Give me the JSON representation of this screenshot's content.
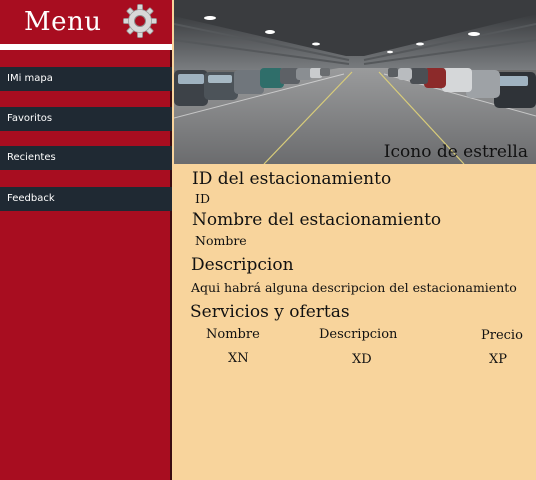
{
  "sidebar": {
    "title": "Menu",
    "settings_icon": "gear-icon",
    "items": [
      {
        "label": "IMi mapa"
      },
      {
        "label": "Favoritos"
      },
      {
        "label": "Recientes"
      },
      {
        "label": "Feedback"
      }
    ]
  },
  "photo": {
    "subject": "parking-garage-photo",
    "caption": "Icono de estrella"
  },
  "details": {
    "id_heading": "ID del estacionamiento",
    "id_value": "ID",
    "name_heading": "Nombre del estacionamiento",
    "name_value": "Nombre",
    "description_heading": "Descripcion",
    "description_value": "Aqui habrá alguna descripcion del estacionamiento",
    "services_heading": "Servicios y ofertas",
    "services_table": {
      "headers": [
        "Nombre",
        "Descripcion",
        "Precio"
      ],
      "rows": [
        [
          "XN",
          "XD",
          "XP"
        ]
      ]
    }
  },
  "colors": {
    "sidebar": "#a80d20",
    "nav_item": "#1f2933",
    "content_background": "#f8d49c"
  }
}
